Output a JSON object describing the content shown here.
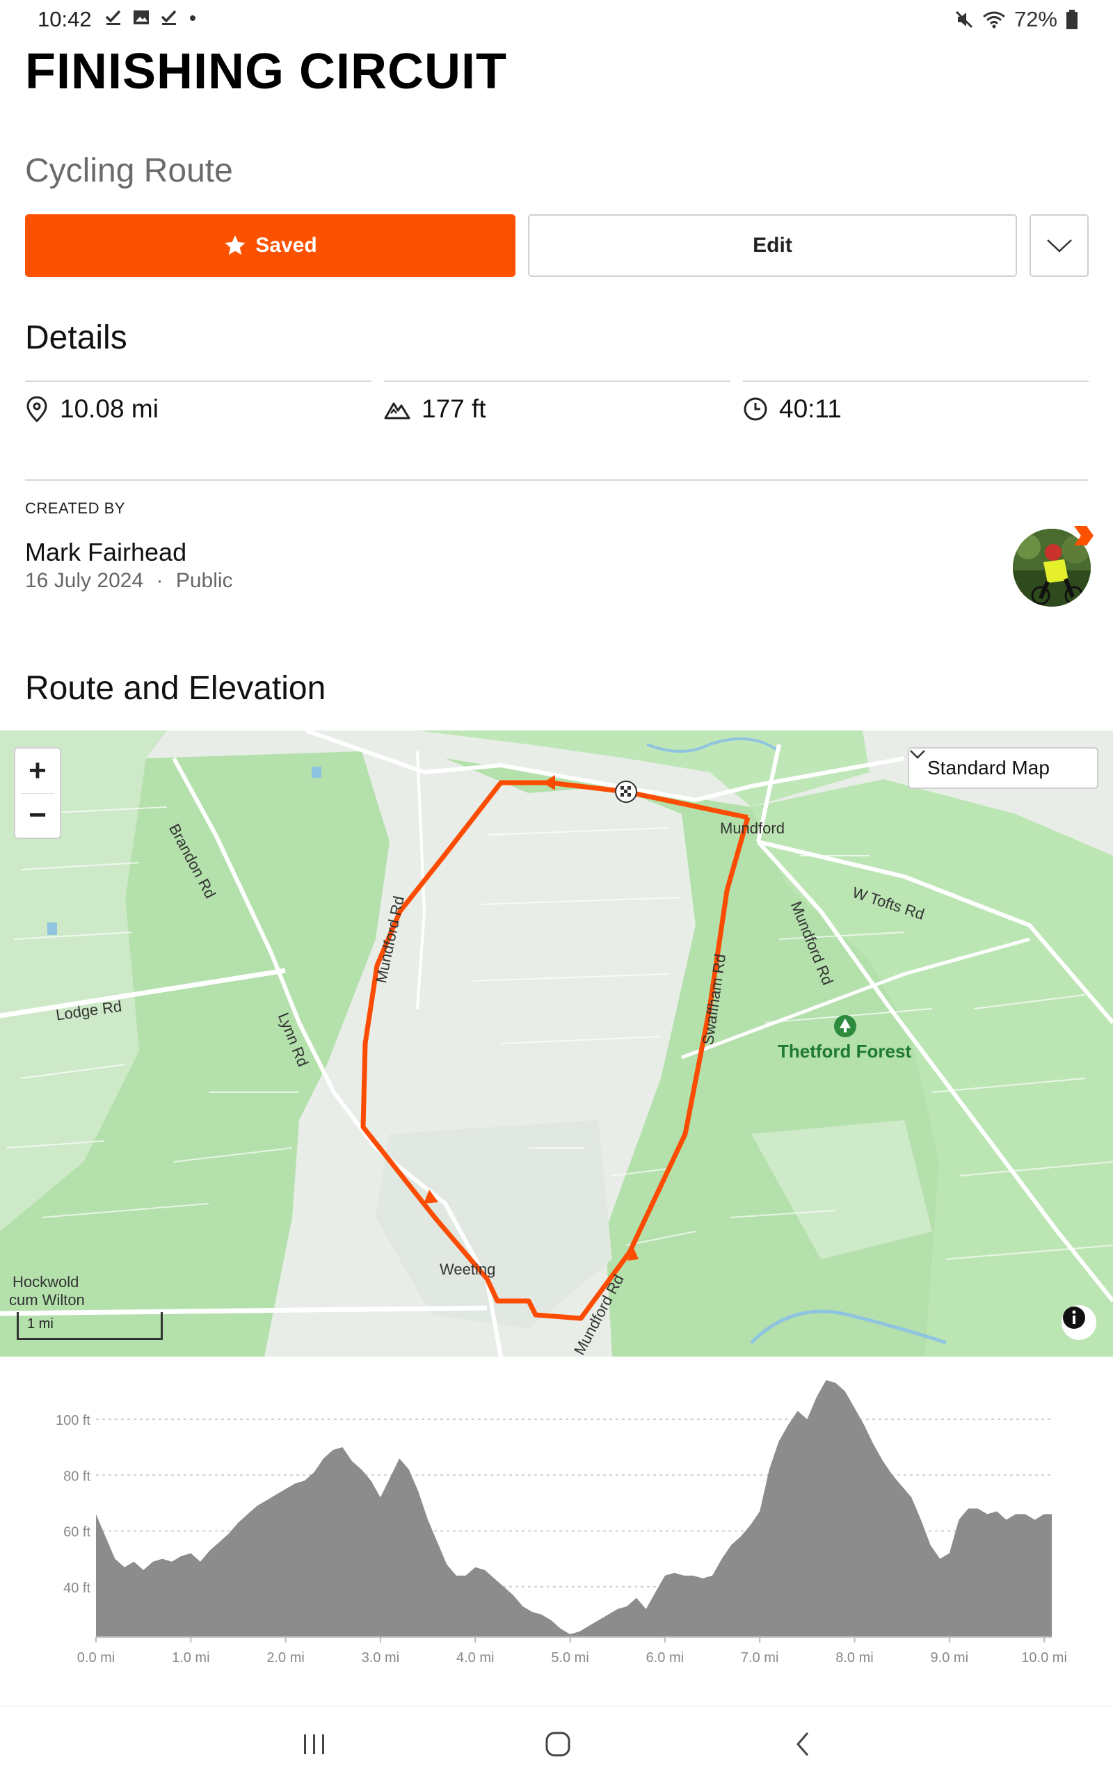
{
  "status_bar": {
    "time": "10:42",
    "battery": "72%"
  },
  "route": {
    "title": "FINISHING CIRCUIT",
    "type": "Cycling Route"
  },
  "actions": {
    "saved_label": "Saved",
    "edit_label": "Edit"
  },
  "details": {
    "heading": "Details",
    "distance": "10.08 mi",
    "elevation": "177 ft",
    "time": "40:11"
  },
  "creator": {
    "label": "CREATED BY",
    "name": "Mark Fairhead",
    "date": "16 July 2024",
    "separator": "·",
    "visibility": "Public"
  },
  "route_elevation": {
    "heading": "Route and Elevation"
  },
  "map": {
    "map_type": "Standard Map",
    "scale": "1 mi",
    "zoom_in": "+",
    "zoom_out": "−",
    "places": {
      "mundford": "Mundford",
      "weeting": "Weeting",
      "hockwold": "Hockwold",
      "hockwold_2": "cum Wilton",
      "thetford_forest": "Thetford Forest"
    },
    "roads": {
      "brandon_rd": "Brandon Rd",
      "lodge_rd": "Lodge Rd",
      "lynn_rd": "Lynn Rd",
      "mundford_rd_west": "Mundford Rd",
      "swaffham_rd": "Swaffham Rd",
      "mundford_rd_east": "Mundford Rd",
      "w_tofts_rd": "W Tofts Rd",
      "mundford_rd_south": "Mundford Rd"
    },
    "colors": {
      "route": "#fc4c02",
      "forest": "#b7e3b0",
      "background": "#e6ece6"
    }
  },
  "chart_data": {
    "type": "area",
    "xlabel": "",
    "ylabel": "",
    "x_ticks": [
      "0.0 mi",
      "1.0 mi",
      "2.0 mi",
      "3.0 mi",
      "4.0 mi",
      "5.0 mi",
      "6.0 mi",
      "7.0 mi",
      "8.0 mi",
      "9.0 mi",
      "10.0 mi"
    ],
    "y_ticks": [
      "40 ft",
      "60 ft",
      "80 ft",
      "100 ft"
    ],
    "xlim": [
      0,
      10.08
    ],
    "ylim": [
      22,
      100
    ],
    "grid": true,
    "series": [
      {
        "x": [
          0,
          0.1,
          0.2,
          0.3,
          0.4,
          0.5,
          0.6,
          0.7,
          0.8,
          0.9,
          1.0,
          1.1,
          1.2,
          1.3,
          1.4,
          1.5,
          1.6,
          1.7,
          1.8,
          1.9,
          2.0,
          2.1,
          2.2,
          2.3,
          2.4,
          2.5,
          2.6,
          2.7,
          2.8,
          2.9,
          3.0,
          3.1,
          3.2,
          3.3,
          3.4,
          3.5,
          3.6,
          3.7,
          3.8,
          3.9,
          4.0,
          4.1,
          4.2,
          4.3,
          4.4,
          4.5,
          4.6,
          4.7,
          4.8,
          4.9,
          5.0,
          5.1,
          5.2,
          5.3,
          5.4,
          5.5,
          5.6,
          5.7,
          5.8,
          5.9,
          6.0,
          6.1,
          6.2,
          6.3,
          6.4,
          6.5,
          6.6,
          6.7,
          6.8,
          6.9,
          7.0,
          7.1,
          7.2,
          7.3,
          7.4,
          7.5,
          7.6,
          7.7,
          7.8,
          7.9,
          8.0,
          8.1,
          8.2,
          8.3,
          8.4,
          8.5,
          8.6,
          8.7,
          8.8,
          8.9,
          9.0,
          9.1,
          9.2,
          9.3,
          9.4,
          9.5,
          9.6,
          9.7,
          9.8,
          9.9,
          10.0,
          10.08
        ],
        "y": [
          66,
          58,
          50,
          47,
          49,
          46,
          49,
          50,
          49,
          51,
          52,
          49,
          53,
          56,
          59,
          63,
          66,
          69,
          71,
          73,
          75,
          77,
          78,
          81,
          86,
          89,
          90,
          85,
          82,
          78,
          72,
          79,
          86,
          82,
          74,
          64,
          56,
          48,
          44,
          44,
          47,
          46,
          43,
          40,
          37,
          33,
          31,
          30,
          28,
          25,
          23,
          24,
          26,
          28,
          30,
          32,
          33,
          36,
          32,
          38,
          44,
          45,
          44,
          44,
          43,
          44,
          50,
          55,
          58,
          62,
          67,
          82,
          92,
          98,
          103,
          100,
          108,
          114,
          113,
          110,
          104,
          98,
          91,
          85,
          80,
          76,
          72,
          64,
          55,
          50,
          52,
          64,
          68,
          68,
          66,
          67,
          64,
          66,
          66,
          64,
          66,
          66
        ]
      }
    ]
  }
}
